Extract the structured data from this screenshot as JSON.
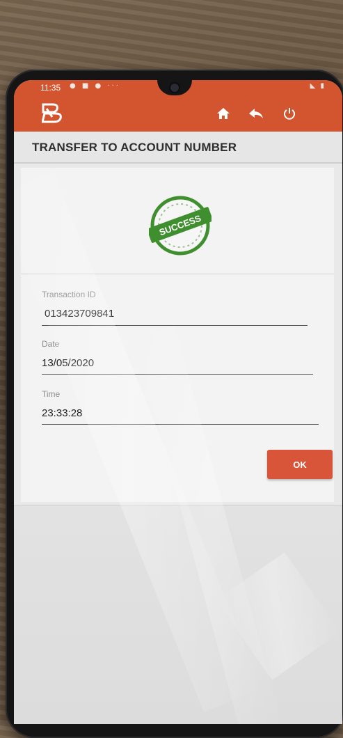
{
  "status_bar": {
    "time": "11:35",
    "left_icons": "● ■ ● ···",
    "right_icons": "◣ ▮"
  },
  "app_bar": {
    "logo_icon": "bank-of-baroda-logo",
    "home_icon": "home-icon",
    "back_icon": "reply-icon",
    "power_icon": "power-icon",
    "brand_color": "#d2552f"
  },
  "page": {
    "title": "TRANSFER TO ACCOUNT NUMBER"
  },
  "result": {
    "stamp_text": "SUCCESS",
    "stamp_color": "#3f8f2f"
  },
  "fields": [
    {
      "label": "Transaction ID",
      "value": "013423709841"
    },
    {
      "label": "Date",
      "value": "13/05/2020"
    },
    {
      "label": "Time",
      "value": "23:33:28"
    }
  ],
  "actions": {
    "ok_label": "OK",
    "ok_color": "#d8553a"
  }
}
